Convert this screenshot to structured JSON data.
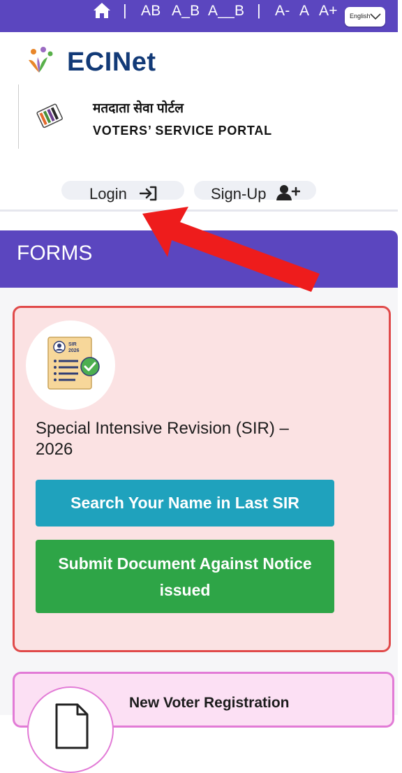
{
  "topbar": {
    "font_sizes": [
      "AB",
      "A_B",
      "A__B"
    ],
    "text_sizes": [
      "A-",
      "A",
      "A+"
    ],
    "language": "English",
    "icons": [
      "home-icon",
      "chevron-down-icon"
    ]
  },
  "brand": {
    "logo_text": "ECINet",
    "hindi_title": "मतदाता सेवा पोर्टल",
    "portal_title": "VOTERS’ SERVICE PORTAL"
  },
  "auth": {
    "login_label": "Login",
    "signup_label": "Sign-Up"
  },
  "forms": {
    "heading": "FORMS",
    "cards": [
      {
        "title": "Special Intensive Revision (SIR) – 2026",
        "icon_text_1": "SIR",
        "icon_text_2": "2026",
        "buttons": [
          "Search Your Name in Last SIR",
          "Submit Document Against Notice issued"
        ]
      },
      {
        "title": "New Voter Registration"
      }
    ]
  },
  "colors": {
    "primary": "#5b46bf",
    "sir_card_border": "#e04a4a",
    "sir_card_bg": "#fbe2e3",
    "search_button": "#1fa2bd",
    "submit_button": "#2ea547",
    "new_voter_border": "#e27bd6",
    "annotation_arrow": "#ee1c1c"
  }
}
